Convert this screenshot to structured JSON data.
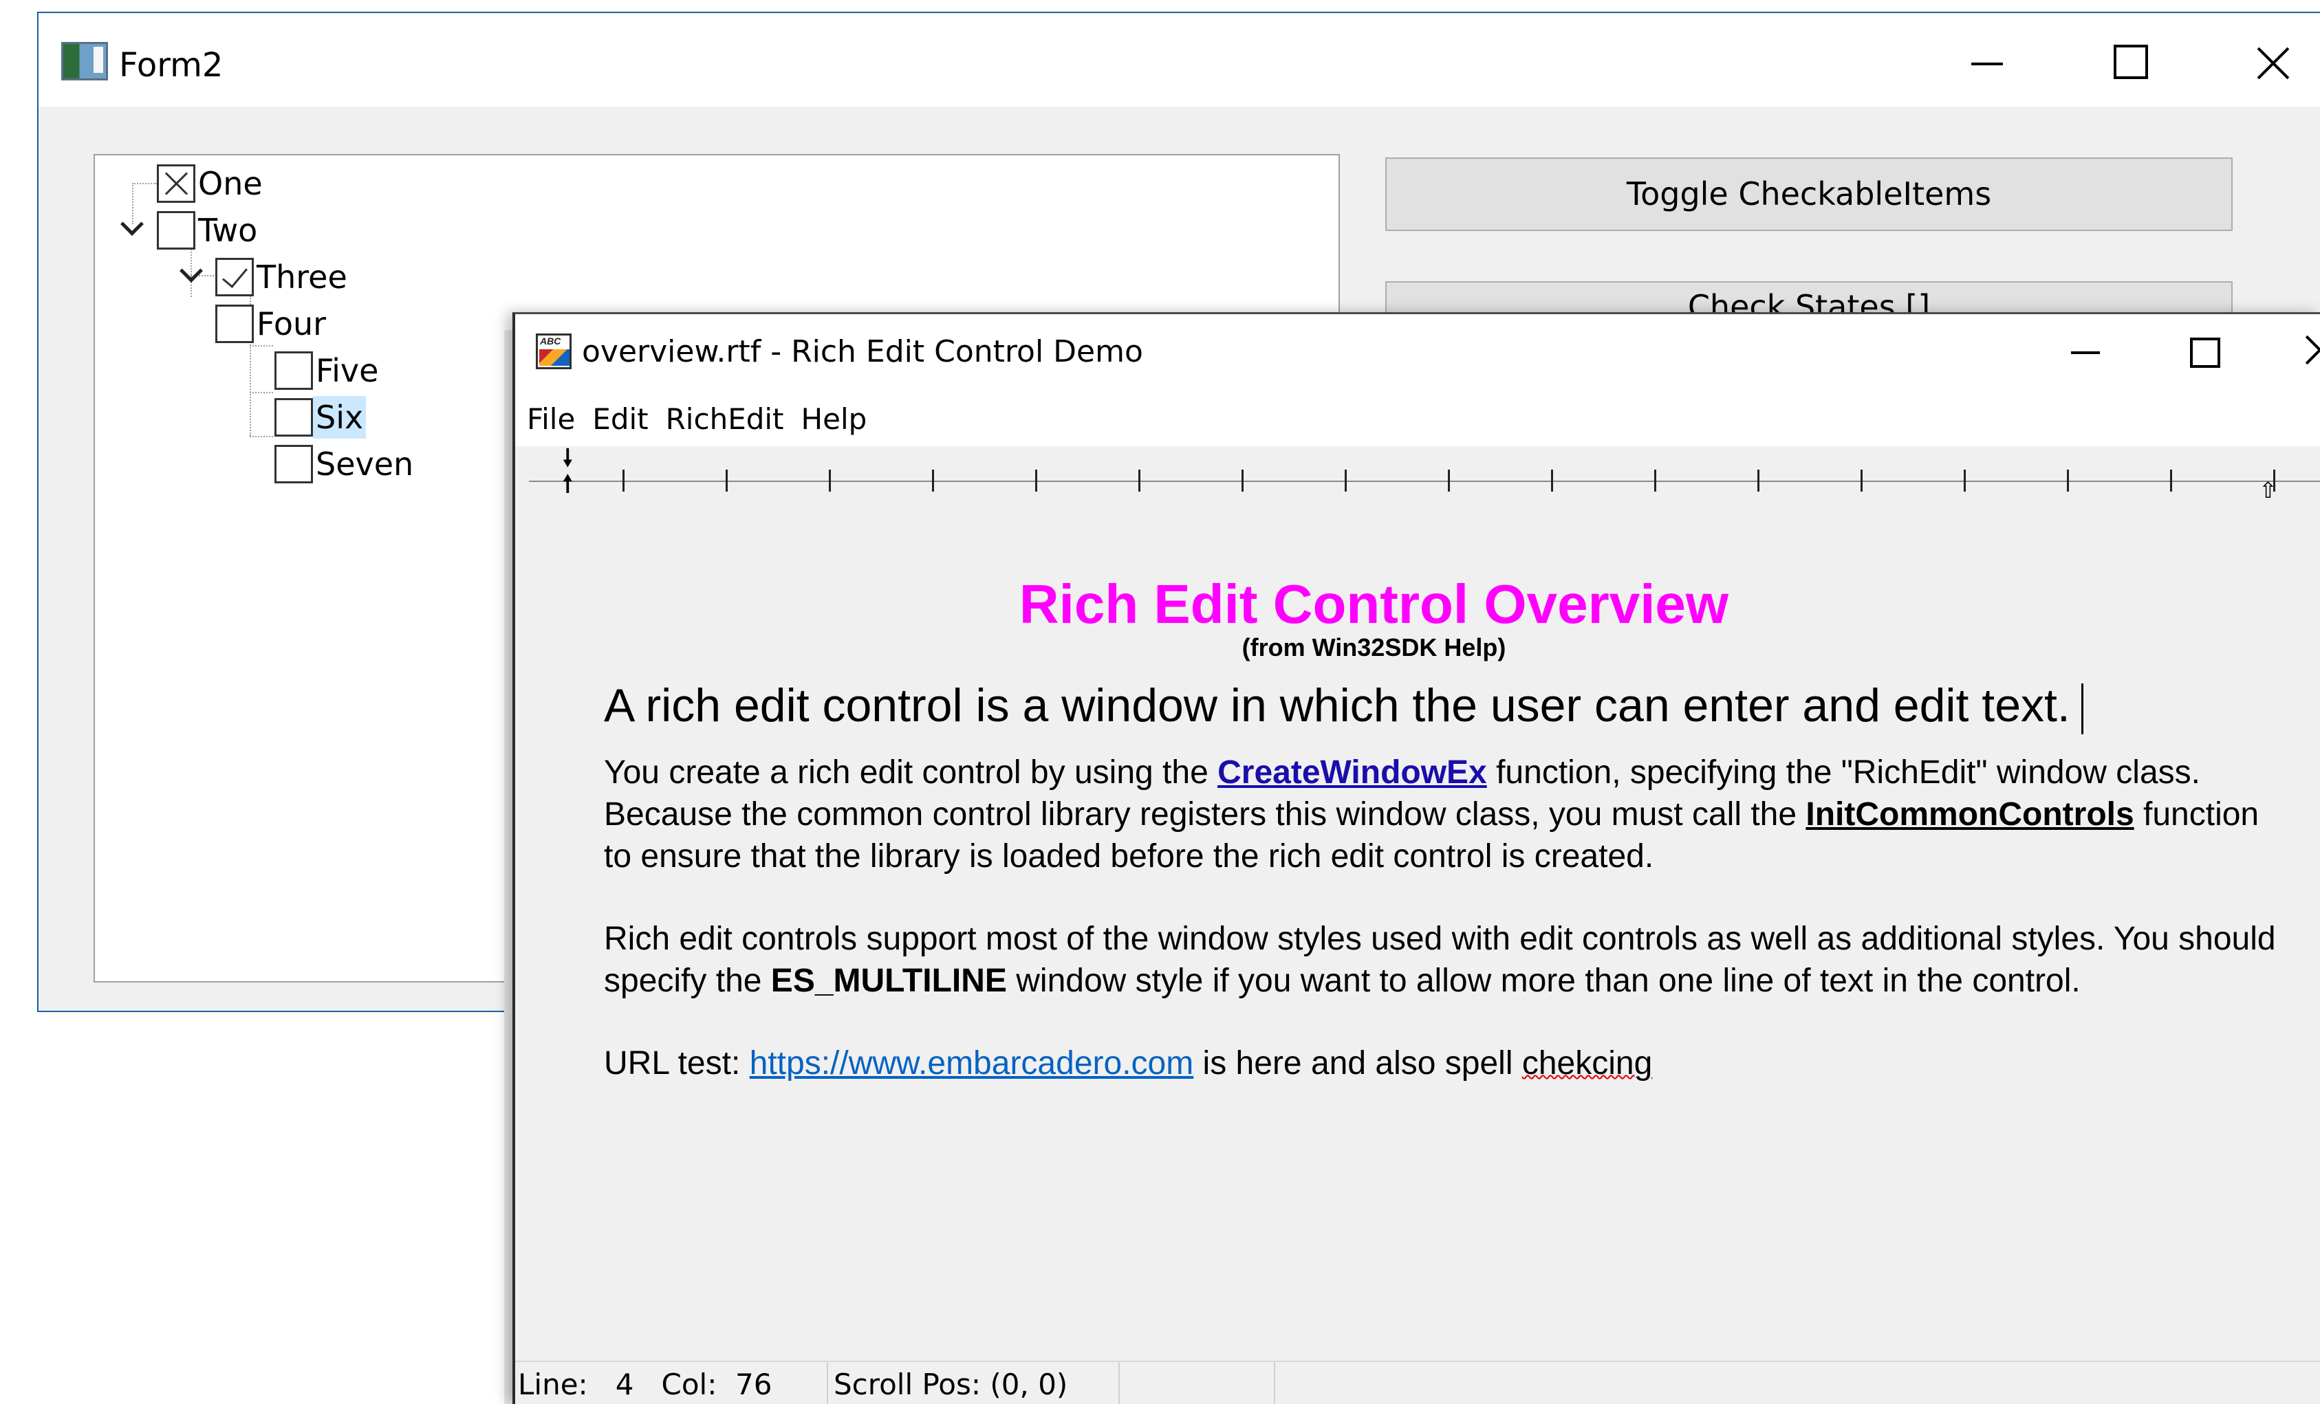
{
  "form2": {
    "title": "Form2",
    "tree": [
      {
        "label": "One",
        "state": "x"
      },
      {
        "label": "Two",
        "state": "unchecked"
      },
      {
        "label": "Three",
        "state": "checked"
      },
      {
        "label": "Four",
        "state": "unchecked"
      },
      {
        "label": "Five",
        "state": "unchecked"
      },
      {
        "label": "Six",
        "state": "unchecked",
        "selected": true
      },
      {
        "label": "Seven",
        "state": "unchecked"
      }
    ],
    "buttons": {
      "toggle": "Toggle CheckableItems",
      "second": "Check States []"
    }
  },
  "rich": {
    "title": "overview.rtf - Rich Edit Control Demo",
    "menu": [
      "File",
      "Edit",
      "RichEdit",
      "Help"
    ],
    "doc": {
      "title": "Rich Edit Control Overview",
      "subtitle": "(from Win32SDK Help)",
      "lead": "A rich edit control is a window in which the user can enter and edit text.",
      "p1": {
        "a": "You create a rich edit control by using the ",
        "link1": "CreateWindowEx",
        "b": " function, specifying the \"RichEdit\" window class. Because the common control library registers this window class, you must call the ",
        "link2": "InitCommonControls",
        "c": " function to ensure that the library is loaded before the rich edit control is created."
      },
      "p2": {
        "a": "Rich edit controls support most of the window styles used with edit controls as well as additional styles. You should specify the ",
        "bold": "ES_MULTILINE",
        "b": " window style if you want to allow more than one line of text in the control."
      },
      "p3": {
        "a": "URL test: ",
        "url": "https://www.embarcadero.com",
        "b": " is here and also spell ",
        "misspelled": "chekcing"
      }
    },
    "status": {
      "line": "Line:   4   Col:  76",
      "scroll": "Scroll Pos: (0, 0)"
    }
  },
  "colors": {
    "title_magenta": "#ff00ff",
    "link_blue": "#1a0dab",
    "selection": "#cce8ff"
  }
}
